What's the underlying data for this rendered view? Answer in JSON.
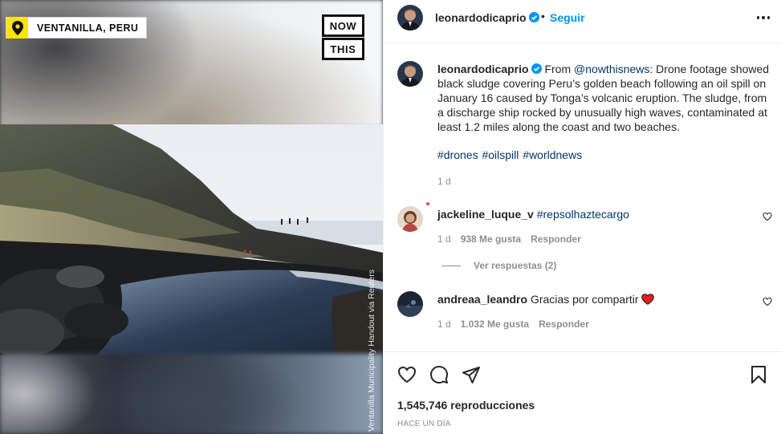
{
  "media": {
    "location_label": "VENTANILLA, PERU",
    "logo_line1": "NOW",
    "logo_line2": "THIS",
    "credit": "Ventanilla Municipality Handout via Reuters"
  },
  "header": {
    "username": "leonardodicaprio",
    "separator": "•",
    "follow_label": "Seguir"
  },
  "caption": {
    "username": "leonardodicaprio",
    "text_prefix": "From ",
    "mention": "@nowthisnews",
    "text_body": ": Drone footage showed black sludge covering Peru’s golden beach following an oil spill on January 16 caused by Tonga’s volcanic eruption. The sludge, from a discharge ship rocked by unusually high waves, contaminated at least 1.2 miles along the coast and two beaches.",
    "hashtags": "#drones #oilspill #worldnews",
    "time": "1 d"
  },
  "comments": [
    {
      "username": "jackeline_luque_v",
      "text": "#repsolhaztecargo",
      "time": "1 d",
      "likes": "938 Me gusta",
      "reply_label": "Responder",
      "view_replies": "Ver respuestas (2)"
    },
    {
      "username": "andreaa_leandro",
      "text": "Gracias por compartir",
      "emoji": "❤️",
      "time": "1 d",
      "likes": "1.032 Me gusta",
      "reply_label": "Responder"
    }
  ],
  "footer": {
    "views_count": "1,545,746",
    "views_label": "reproducciones",
    "posted": "HACE UN DÍA"
  },
  "colors": {
    "accent": "#0095f6",
    "link": "#00376b",
    "muted": "#8e8e8e",
    "badge_yellow": "#ffe600"
  }
}
